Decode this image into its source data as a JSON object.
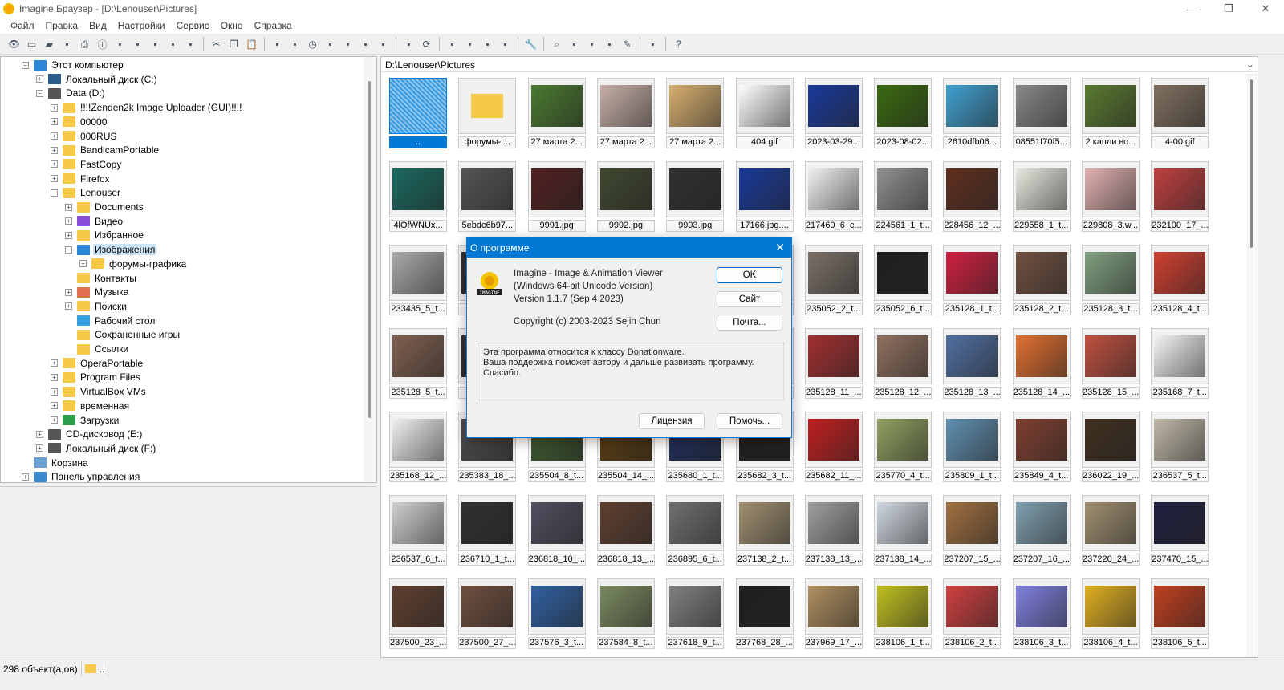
{
  "window": {
    "title": "Imagine Браузер - [D:\\Lenouser\\Pictures]",
    "minimize": "—",
    "maximize": "❐",
    "close": "✕"
  },
  "menu": [
    "Файл",
    "Правка",
    "Вид",
    "Настройки",
    "Сервис",
    "Окно",
    "Справка"
  ],
  "toolbar_icons": [
    "eye",
    "open",
    "folder-open",
    "copy-out",
    "print",
    "info",
    "camera",
    "new-folder",
    "rename",
    "delete",
    "properties",
    "|",
    "cut",
    "copy",
    "paste",
    "|",
    "window",
    "tree",
    "clock",
    "thumbs",
    "grid",
    "fit",
    "image",
    "|",
    "folder-up",
    "refresh",
    "|",
    "view1",
    "view2",
    "view3",
    "view4",
    "|",
    "wrench",
    "|",
    "find",
    "convert",
    "capture",
    "filmstrip",
    "edit",
    "|",
    "notes",
    "|",
    "help"
  ],
  "tree": [
    {
      "l": 0,
      "t": "Этот компьютер",
      "pm": "−",
      "icon": "computer",
      "c": "#2b88d8"
    },
    {
      "l": 1,
      "t": "Локальный диск (C:)",
      "pm": "+",
      "icon": "drive",
      "c": "#2b5d8c"
    },
    {
      "l": 1,
      "t": "Data (D:)",
      "pm": "−",
      "icon": "drive",
      "c": "#555"
    },
    {
      "l": 2,
      "t": "!!!!Zenden2k Image Uploader (GUI)!!!!",
      "pm": "+",
      "icon": "folder",
      "c": "#f7c948"
    },
    {
      "l": 2,
      "t": "00000",
      "pm": "+",
      "icon": "folder",
      "c": "#f7c948"
    },
    {
      "l": 2,
      "t": "000RUS",
      "pm": "+",
      "icon": "folder",
      "c": "#f7c948"
    },
    {
      "l": 2,
      "t": "BandicamPortable",
      "pm": "+",
      "icon": "folder",
      "c": "#f7c948"
    },
    {
      "l": 2,
      "t": "FastCopy",
      "pm": "+",
      "icon": "folder",
      "c": "#f7c948"
    },
    {
      "l": 2,
      "t": "Firefox",
      "pm": "+",
      "icon": "folder",
      "c": "#f7c948"
    },
    {
      "l": 2,
      "t": "Lenouser",
      "pm": "−",
      "icon": "folder",
      "c": "#f7c948"
    },
    {
      "l": 3,
      "t": "Documents",
      "pm": "+",
      "icon": "folder",
      "c": "#f7c948"
    },
    {
      "l": 3,
      "t": "Видео",
      "pm": "+",
      "icon": "video",
      "c": "#8a4fd8"
    },
    {
      "l": 3,
      "t": "Избранное",
      "pm": "+",
      "icon": "folder",
      "c": "#f7c948"
    },
    {
      "l": 3,
      "t": "Изображения",
      "pm": "−",
      "icon": "pictures",
      "c": "#2b88d8",
      "sel": true
    },
    {
      "l": 4,
      "t": "форумы-графика",
      "pm": "+",
      "icon": "folder",
      "c": "#f7c948"
    },
    {
      "l": 3,
      "t": "Контакты",
      "pm": "",
      "icon": "folder",
      "c": "#f7c948"
    },
    {
      "l": 3,
      "t": "Музыка",
      "pm": "+",
      "icon": "music",
      "c": "#e07050"
    },
    {
      "l": 3,
      "t": "Поиски",
      "pm": "+",
      "icon": "folder",
      "c": "#f7c948"
    },
    {
      "l": 3,
      "t": "Рабочий стол",
      "pm": "",
      "icon": "desktop",
      "c": "#3aa0e0"
    },
    {
      "l": 3,
      "t": "Сохраненные игры",
      "pm": "",
      "icon": "folder",
      "c": "#f7c948"
    },
    {
      "l": 3,
      "t": "Ссылки",
      "pm": "",
      "icon": "folder",
      "c": "#f7c948"
    },
    {
      "l": 2,
      "t": "OperaPortable",
      "pm": "+",
      "icon": "folder",
      "c": "#f7c948"
    },
    {
      "l": 2,
      "t": "Program Files",
      "pm": "+",
      "icon": "folder",
      "c": "#f7c948"
    },
    {
      "l": 2,
      "t": "VirtualBox VMs",
      "pm": "+",
      "icon": "folder",
      "c": "#f7c948"
    },
    {
      "l": 2,
      "t": "временная",
      "pm": "+",
      "icon": "folder",
      "c": "#f7c948"
    },
    {
      "l": 2,
      "t": "Загрузки",
      "pm": "+",
      "icon": "download",
      "c": "#2a9d4a"
    },
    {
      "l": 1,
      "t": "CD-дисковод (E:)",
      "pm": "+",
      "icon": "cd-drive",
      "c": "#555"
    },
    {
      "l": 1,
      "t": "Локальный диск (F:)",
      "pm": "+",
      "icon": "drive",
      "c": "#555"
    },
    {
      "l": 0,
      "t": "Корзина",
      "pm": "",
      "icon": "recycle-bin",
      "c": "#6aa0d0"
    },
    {
      "l": 0,
      "t": "Панель управления",
      "pm": "+",
      "icon": "control-panel",
      "c": "#3a8ad0"
    }
  ],
  "address": "D:\\Lenouser\\Pictures",
  "files": [
    [
      "..",
      "форумы-г...",
      "27 марта 2...",
      "27 марта 2...",
      "27 марта 2...",
      "404.gif",
      "2023-03-29...",
      "2023-08-02...",
      "2610dfb06...",
      "08551f70f5...",
      "2 капли во...",
      "4-00.gif"
    ],
    [
      "4lOfWNUx...",
      "5ebdc6b97...",
      "9991.jpg",
      "9992.jpg",
      "9993.jpg",
      "17166.jpg....",
      "217460_6_c...",
      "224561_1_t...",
      "228456_12_...",
      "229558_1_t...",
      "229808_3.w...",
      "232100_17_..."
    ],
    [
      "233435_5_t...",
      "2",
      "",
      "",
      "",
      "",
      "235052_2_t...",
      "235052_6_t...",
      "235128_1_t...",
      "235128_2_t...",
      "235128_3_t...",
      "235128_4_t..."
    ],
    [
      "235128_5_t...",
      "2",
      "",
      "",
      "",
      "",
      "235128_11_...",
      "235128_12_...",
      "235128_13_...",
      "235128_14_...",
      "235128_15_...",
      "235168_7_t..."
    ],
    [
      "235168_12_...",
      "235383_18_...",
      "235504_8_t...",
      "235504_14_...",
      "235680_1_t...",
      "235682_3_t...",
      "235682_11_...",
      "235770_4_t...",
      "235809_1_t...",
      "235849_4_t...",
      "236022_19_...",
      "236537_5_t..."
    ],
    [
      "236537_6_t...",
      "236710_1_t...",
      "236818_10_...",
      "236818_13_...",
      "236895_6_t...",
      "237138_2_t...",
      "237138_13_...",
      "237138_14_...",
      "237207_15_...",
      "237207_16_...",
      "237220_24_...",
      "237470_15_..."
    ],
    [
      "237500_23_...",
      "237500_27_...",
      "237576_3_t...",
      "237584_8_t...",
      "237618_9_t...",
      "237768_28_...",
      "237969_17_...",
      "238106_1_t...",
      "238106_2_t...",
      "238106_3_t...",
      "238106_4_t...",
      "238106_5_t..."
    ]
  ],
  "thumb_colors": [
    [
      "#3a9ae0",
      "#f7c948",
      "#4a7a30",
      "#c8b0a8",
      "#d8b070",
      "#ffffff",
      "#1a3a9a",
      "#3a6a10",
      "#40a0d0",
      "#888888",
      "#5a7a30",
      "#807060"
    ],
    [
      "#1a6a60",
      "#555555",
      "#502020",
      "#404830",
      "#303030",
      "#1a3a9a",
      "#f0f0f0",
      "#909090",
      "#603020",
      "#e8e8e0",
      "#e0b0b0",
      "#c04040"
    ],
    [
      "#aaaaaa",
      "#333333",
      "#f0f0f0",
      "#f0f0f0",
      "#f0f0f0",
      "#f0f0f0",
      "#7a7068",
      "#202020",
      "#d02040",
      "#705040",
      "#80a080",
      "#d04030"
    ],
    [
      "#806050",
      "#333333",
      "#f0f0f0",
      "#f0f0f0",
      "#f0f0f0",
      "#f0f0f0",
      "#a03030",
      "#907060",
      "#5070a0",
      "#e07030",
      "#c05040",
      "#f4f4f4"
    ],
    [
      "#f0f0f0",
      "#505050",
      "#406030",
      "#604010",
      "#203060",
      "#202020",
      "#c02020",
      "#90a060",
      "#6090b0",
      "#804030",
      "#403020",
      "#c0b8a8"
    ],
    [
      "#d0d0d0",
      "#303030",
      "#505060",
      "#604030",
      "#707070",
      "#a09070",
      "#a0a0a0",
      "#d0d8e0",
      "#a07040",
      "#80a0b0",
      "#a09070",
      "#202040"
    ],
    [
      "#604030",
      "#705040",
      "#3060a0",
      "#7a8a60",
      "#808080",
      "#202020",
      "#b09060",
      "#c0c020",
      "#d04040",
      "#8080e0",
      "#e0b020",
      "#c04020"
    ]
  ],
  "status": {
    "count": "298 объект(а,ов)",
    "path": ".."
  },
  "dialog": {
    "title": "О программе",
    "close": "✕",
    "line1": "Imagine - Image & Animation Viewer",
    "line2": "(Windows 64-bit Unicode Version)",
    "line3": "Version 1.1.7 (Sep  4 2023)",
    "copyright": "Copyright (c) 2003-2023 Sejin Chun",
    "logo_text": "IMAGINE",
    "memo": "Эта программа относится к классу Donationware.\nВаша поддержка поможет автору и дальше развивать программу.\nСпасибо.",
    "ok": "OK",
    "site": "Сайт",
    "mail": "Почта...",
    "license": "Лицензия",
    "help": "Помочь..."
  }
}
